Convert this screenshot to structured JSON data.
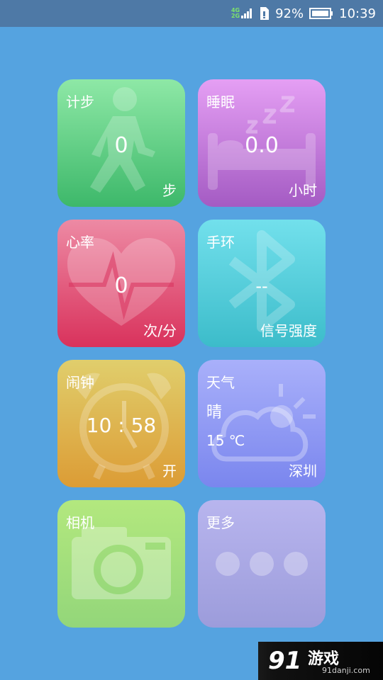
{
  "status_bar": {
    "net_top": "4G",
    "net_bottom": "2G",
    "battery": "92%",
    "time": "10:39"
  },
  "tiles": {
    "steps": {
      "title": "计步",
      "value": "0",
      "unit": "步",
      "icon": "walking-person-icon"
    },
    "sleep": {
      "title": "睡眠",
      "value": "0.0",
      "unit": "小时",
      "icon": "bed-zzz-icon"
    },
    "heart": {
      "title": "心率",
      "value": "0",
      "unit": "次/分",
      "icon": "heartbeat-icon"
    },
    "band": {
      "title": "手环",
      "value": "--",
      "unit": "信号强度",
      "icon": "bluetooth-icon"
    },
    "alarm": {
      "title": "闹钟",
      "value": "10 : 58",
      "unit": "开",
      "icon": "alarm-clock-icon"
    },
    "weather": {
      "title": "天气",
      "condition": "晴",
      "temperature": "15 ℃",
      "city": "深圳",
      "icon": "sun-cloud-icon"
    },
    "camera": {
      "title": "相机",
      "icon": "camera-icon"
    },
    "more": {
      "title": "更多",
      "icon": "three-dots-icon"
    }
  },
  "watermark": {
    "logo": "游戏",
    "url": "91danji.com"
  },
  "colors": {
    "background": "#55a3e0",
    "status_bar": "#4e79a6",
    "steps": "#3db86a",
    "sleep": "#a45bc3",
    "heart": "#d9325c",
    "band": "#3cbcca",
    "alarm": "#dc9c35",
    "weather": "#7a86ee",
    "camera": "#93d67a",
    "more": "#9c9cdb"
  }
}
